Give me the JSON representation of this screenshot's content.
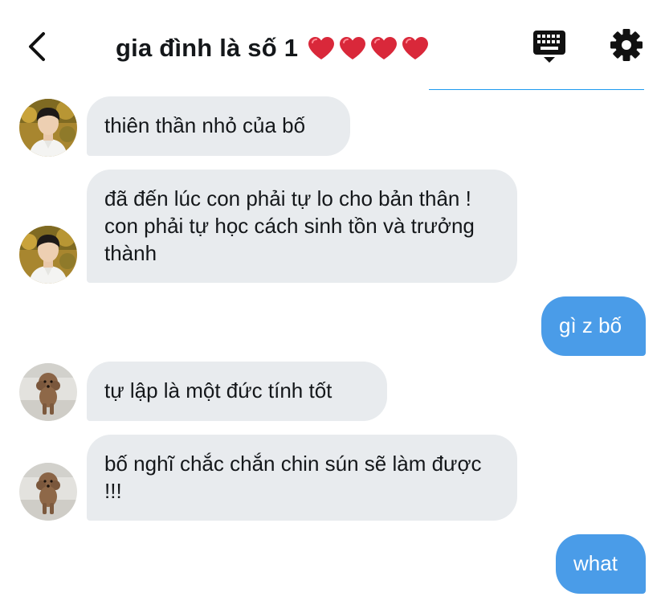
{
  "header": {
    "title": "gia đình là số 1",
    "hearts": [
      "❤️",
      "❤️",
      "❤️",
      "❤️"
    ],
    "icons": [
      "back-chevron-icon",
      "keyboard-icon",
      "gear-icon"
    ]
  },
  "colors": {
    "incoming_bubble": "#e8ebee",
    "outgoing_bubble": "#4a9ce8",
    "accent": "#1d9bf0",
    "heart": "#e0303f"
  },
  "messages": [
    {
      "direction": "in",
      "avatar": "young-man-avatar",
      "text": "thiên thần nhỏ của bố"
    },
    {
      "direction": "in",
      "avatar": "young-man-avatar",
      "text": "đã đến lúc con phải tự lo cho bản thân ! con phải tự học cách sinh tồn và trưởng thành"
    },
    {
      "direction": "out",
      "text": "gì z bố"
    },
    {
      "direction": "in",
      "avatar": "poodle-avatar",
      "text": "tự lập là một đức tính tốt"
    },
    {
      "direction": "in",
      "avatar": "poodle-avatar",
      "text": "bố nghĩ chắc chắn chin sún sẽ làm được !!!"
    },
    {
      "direction": "out",
      "text": "what"
    }
  ]
}
